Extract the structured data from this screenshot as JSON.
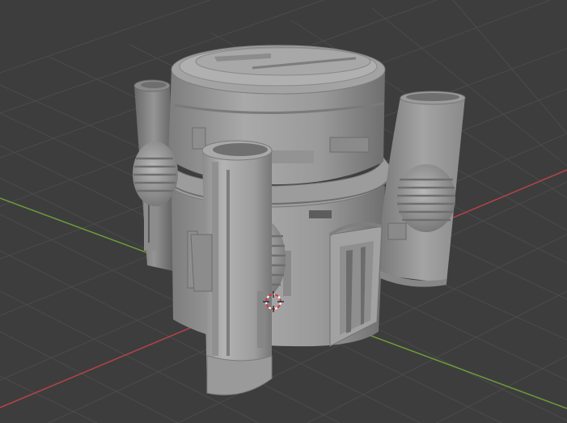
{
  "viewport": {
    "background_color": "#3d3d3d",
    "grid_color": "#4a4a4a",
    "x_axis_color": "#b5424a",
    "y_axis_color": "#6d9a3a",
    "model_color": "#a8a8a8",
    "cursor_icon": "3d-cursor-icon"
  }
}
